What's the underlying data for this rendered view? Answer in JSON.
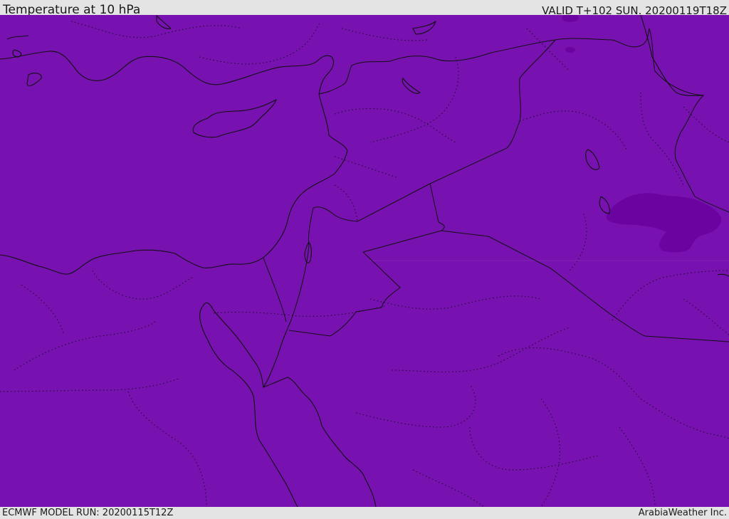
{
  "header": {
    "title": "Temperature at 10 hPa",
    "valid_time": "VALID T+102 SUN. 20200119T18Z"
  },
  "footer": {
    "model_run": "ECMWF MODEL RUN: 20200115T12Z",
    "credit": "ArabiaWeather Inc."
  },
  "map": {
    "field_color": "#7711b0",
    "cold_pool_color": "#6a039f",
    "coastline_color": "#111111",
    "border_style": "solid",
    "province_border_style": "dotted"
  }
}
